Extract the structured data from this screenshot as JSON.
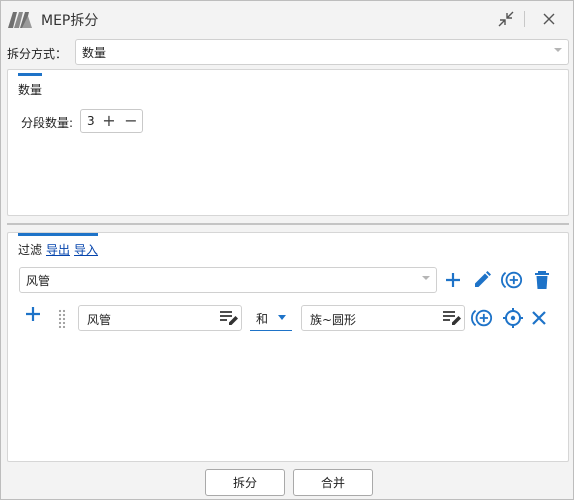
{
  "window": {
    "title": "MEP拆分"
  },
  "mode": {
    "label": "拆分方式：",
    "value": "数量"
  },
  "quantity_panel": {
    "tab": "数量",
    "segments_label": "分段数量:",
    "segments_value": "3",
    "plus": "+",
    "minus": "−"
  },
  "filter_panel": {
    "tab": "过滤",
    "export_link": "导出",
    "import_link": "导入",
    "selector_value": "风管",
    "condition": {
      "field": "风管",
      "operator": "和",
      "value": "族~圆形"
    }
  },
  "buttons": {
    "split": "拆分",
    "merge": "合并"
  },
  "colors": {
    "accent": "#1e73c8"
  }
}
